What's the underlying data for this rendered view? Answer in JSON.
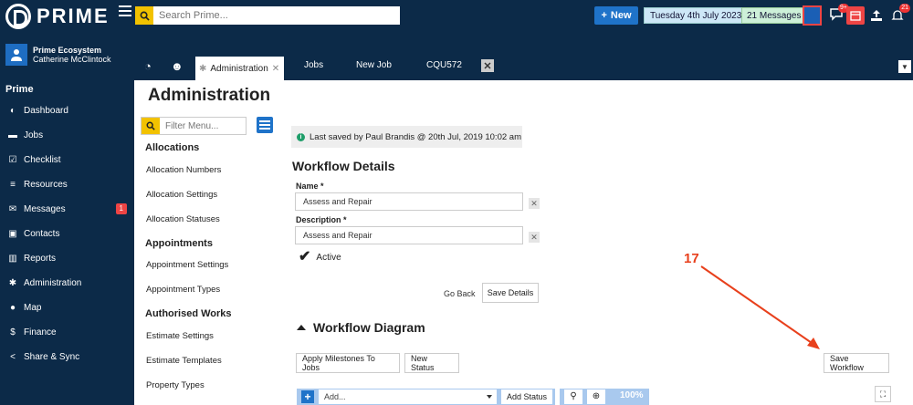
{
  "app": {
    "name": "PRIME"
  },
  "topbar": {
    "search_placeholder": "Search Prime...",
    "new_label": "New",
    "date": "Tuesday 4th July 2023",
    "messages": "21 Messages",
    "notif_badge": "9+",
    "upload_badge": "21"
  },
  "user": {
    "org": "Prime Ecosystem",
    "name": "Catherine McClintock"
  },
  "sidebar": {
    "section": "Prime",
    "items": [
      {
        "label": "Dashboard",
        "icon": "dashboard-icon"
      },
      {
        "label": "Jobs",
        "icon": "folder-icon"
      },
      {
        "label": "Checklist",
        "icon": "checkbox-icon"
      },
      {
        "label": "Resources",
        "icon": "database-icon"
      },
      {
        "label": "Messages",
        "icon": "envelope-icon",
        "badge": "1"
      },
      {
        "label": "Contacts",
        "icon": "address-book-icon"
      },
      {
        "label": "Reports",
        "icon": "chart-icon"
      },
      {
        "label": "Administration",
        "icon": "gear-icon"
      },
      {
        "label": "Map",
        "icon": "globe-icon"
      },
      {
        "label": "Finance",
        "icon": "dollar-icon"
      },
      {
        "label": "Share & Sync",
        "icon": "share-icon"
      }
    ]
  },
  "tabs": {
    "active": "Administration",
    "items": [
      "Jobs",
      "New Job",
      "CQU572"
    ]
  },
  "page": {
    "title": "Administration"
  },
  "submenu": {
    "filter_placeholder": "Filter Menu...",
    "groups": [
      {
        "heading": "Allocations",
        "items": [
          "Allocation Numbers",
          "Allocation Settings",
          "Allocation Statuses"
        ]
      },
      {
        "heading": "Appointments",
        "items": [
          "Appointment Settings",
          "Appointment Types"
        ]
      },
      {
        "heading": "Authorised Works",
        "items": [
          "Estimate Settings",
          "Estimate Templates",
          "Property Types"
        ]
      }
    ]
  },
  "workflow": {
    "last_saved": "Last saved by Paul Brandis @ 20th Jul, 2019 10:02 am",
    "details_heading": "Workflow Details",
    "name_label": "Name *",
    "name_value": "Assess and Repair",
    "description_label": "Description *",
    "description_value": "Assess and Repair",
    "active_label": "Active",
    "go_back": "Go Back",
    "save_details": "Save Details",
    "diagram_heading": "Workflow Diagram",
    "apply_milestones": "Apply Milestones To Jobs",
    "new_status": "New Status",
    "save_workflow": "Save Workflow",
    "add_placeholder": "Add...",
    "add_status": "Add Status",
    "zoom": "100%"
  },
  "annotation": {
    "number": "17",
    "color": "#e8401c"
  }
}
